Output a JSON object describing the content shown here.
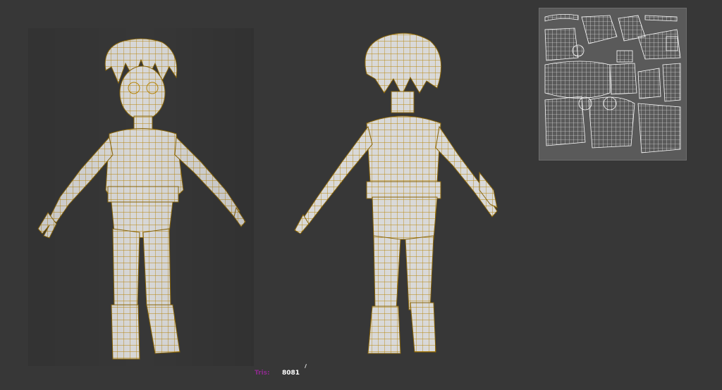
{
  "viewport": {
    "background": "#373737"
  },
  "models": {
    "front": {
      "label": "character-front-view"
    },
    "back": {
      "label": "character-back-view"
    },
    "mesh_fill": "#dcdcdc",
    "wire_color": "#b8860b"
  },
  "uv_panel": {
    "background": "#5a5a5a",
    "line_color": "#ffffff"
  },
  "stats": {
    "tris_label": "Tris:",
    "tris_value": "8081"
  }
}
